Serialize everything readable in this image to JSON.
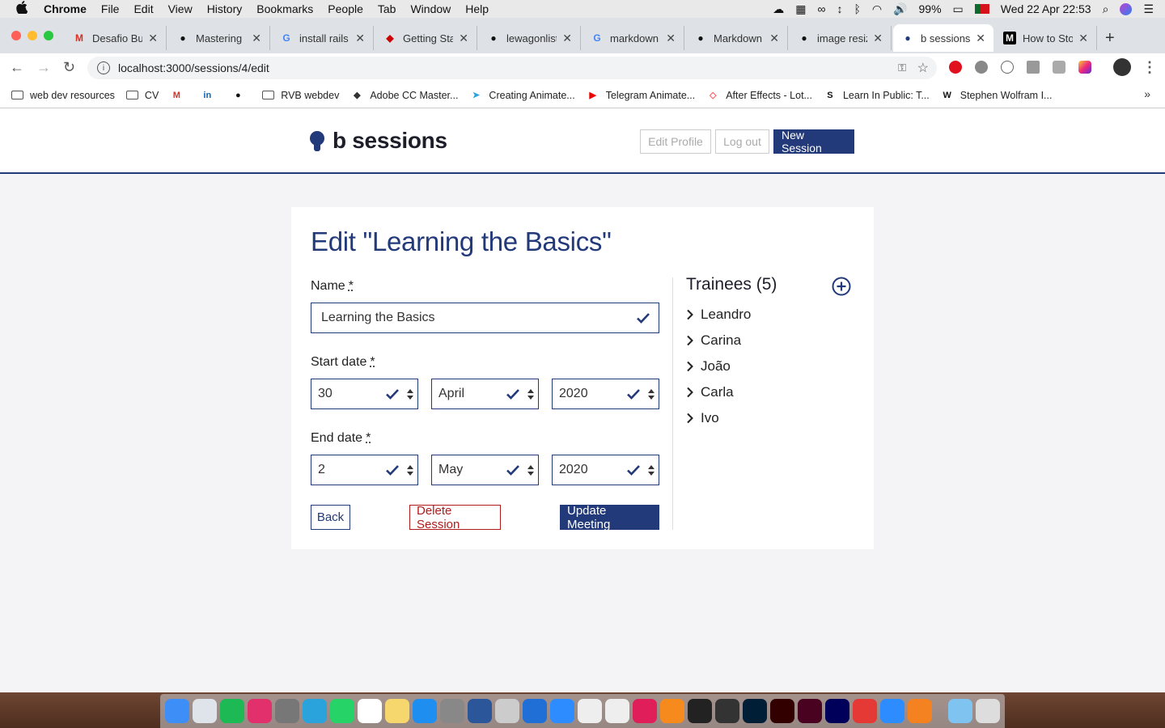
{
  "menubar": {
    "app": "Chrome",
    "items": [
      "File",
      "Edit",
      "View",
      "History",
      "Bookmarks",
      "People",
      "Tab",
      "Window",
      "Help"
    ],
    "battery": "99%",
    "datetime": "Wed 22 Apr  22:53"
  },
  "tabs": [
    {
      "title": "Desafio Bu",
      "icon": "gmail-icon",
      "color": "#d93025"
    },
    {
      "title": "Mastering",
      "icon": "github-icon",
      "color": "#111111"
    },
    {
      "title": "install rails",
      "icon": "google-icon",
      "color": "#4285f4"
    },
    {
      "title": "Getting Sta",
      "icon": "rails-icon",
      "color": "#cc0000"
    },
    {
      "title": "lewagonlist",
      "icon": "github-icon",
      "color": "#111111"
    },
    {
      "title": "markdown",
      "icon": "google-icon",
      "color": "#4285f4"
    },
    {
      "title": "Markdown",
      "icon": "github-icon",
      "color": "#111111"
    },
    {
      "title": "image resiz",
      "icon": "github-icon",
      "color": "#111111"
    },
    {
      "title": "b sessions",
      "icon": "bulb-icon",
      "color": "#233a7a",
      "active": true
    },
    {
      "title": "How to Sto",
      "icon": "medium-icon",
      "color": "#000000"
    }
  ],
  "address": {
    "url": "localhost:3000/sessions/4/edit"
  },
  "bookmarks": [
    {
      "label": "web dev resources",
      "icon": "folder-icon"
    },
    {
      "label": "CV",
      "icon": "folder-icon"
    },
    {
      "label": "",
      "icon": "gmail-icon"
    },
    {
      "label": "",
      "icon": "linkedin-icon"
    },
    {
      "label": "",
      "icon": "github-icon"
    },
    {
      "label": "RVB webdev",
      "icon": "folder-icon"
    },
    {
      "label": "Adobe CC Master...",
      "icon": "udemy-icon"
    },
    {
      "label": "Creating Animate...",
      "icon": "telegram-icon"
    },
    {
      "label": "Telegram Animate...",
      "icon": "youtube-icon"
    },
    {
      "label": "After Effects - Lot...",
      "icon": "airbnb-icon"
    },
    {
      "label": "Learn In Public: T...",
      "icon": "swyx-icon"
    },
    {
      "label": "Stephen Wolfram I...",
      "icon": "wolfram-icon"
    }
  ],
  "site": {
    "brand": "b sessions",
    "edit_profile": "Edit Profile",
    "log_out": "Log out",
    "new_session": "New Session"
  },
  "form": {
    "title": "Edit \"Learning the Basics\"",
    "name_label": "Name",
    "required_mark": "*",
    "name_value": "Learning the Basics",
    "start_label": "Start date",
    "start_day": "30",
    "start_month": "April",
    "start_year": "2020",
    "end_label": "End date",
    "end_day": "2",
    "end_month": "May",
    "end_year": "2020",
    "back": "Back",
    "delete": "Delete Session",
    "update": "Update Meeting"
  },
  "trainees": {
    "title": "Trainees (5)",
    "items": [
      "Leandro",
      "Carina",
      "João",
      "Carla",
      "Ivo"
    ]
  },
  "colors": {
    "brand": "#233a7a",
    "danger": "#b01c1c"
  }
}
